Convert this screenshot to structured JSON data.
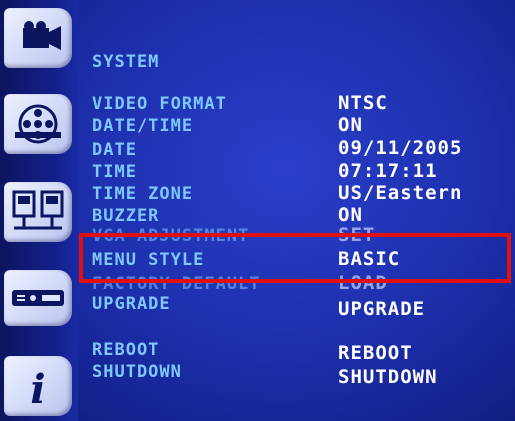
{
  "sidebar": {
    "icons": [
      "camera-icon",
      "film-reel-icon",
      "network-computers-icon",
      "device-io-icon",
      "info-icon"
    ]
  },
  "menu": {
    "title": "SYSTEM",
    "rows": [
      {
        "label": "VIDEO FORMAT",
        "value": "NTSC"
      },
      {
        "label": "DATE/TIME",
        "value": "ON"
      },
      {
        "label": "DATE",
        "value": "09/11/2005"
      },
      {
        "label": "TIME",
        "value": "07:17:11"
      },
      {
        "label": "TIME ZONE",
        "value": "US/Eastern"
      },
      {
        "label": "BUZZER",
        "value": "ON"
      },
      {
        "label": "VGA ADJUSTMENT",
        "value": "SET"
      },
      {
        "label": "MENU STYLE",
        "value": "BASIC"
      },
      {
        "label": "FACTORY DEFAULT",
        "value": "LOAD"
      },
      {
        "label": "UPGRADE",
        "value": "UPGRADE"
      },
      {
        "label": "REBOOT",
        "value": "REBOOT"
      },
      {
        "label": "SHUTDOWN",
        "value": "SHUTDOWN"
      }
    ]
  },
  "colors": {
    "background": "#1e31b0",
    "label": "#7ec8ff",
    "value": "#ffffff",
    "highlight_box": "#e01010"
  }
}
